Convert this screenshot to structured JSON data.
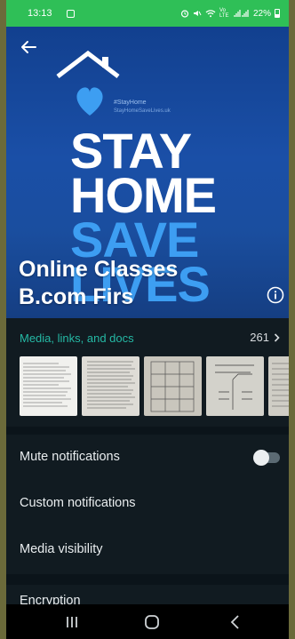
{
  "status_bar": {
    "time": "13:13",
    "signal_text": "Vo LTE",
    "battery": "22%"
  },
  "poster": {
    "hashtag": "#StayHome",
    "tagline": "StayHomeSaveLives.uk",
    "line1": "STAY",
    "line2": "HOME",
    "line3": "SAVE",
    "line4": "LIVES",
    "accent_color": "#3d9ef2"
  },
  "group": {
    "name_line1": "Online Classes",
    "name_line2": "B.com Firs"
  },
  "media": {
    "label": "Media, links, and docs",
    "count": "261"
  },
  "settings": {
    "mute_label": "Mute notifications",
    "mute_on": false,
    "custom_label": "Custom notifications",
    "visibility_label": "Media visibility",
    "encryption_label": "Encryption"
  },
  "colors": {
    "status_bar": "#2fbf57",
    "accent": "#25b9a5",
    "background": "#111b21"
  }
}
